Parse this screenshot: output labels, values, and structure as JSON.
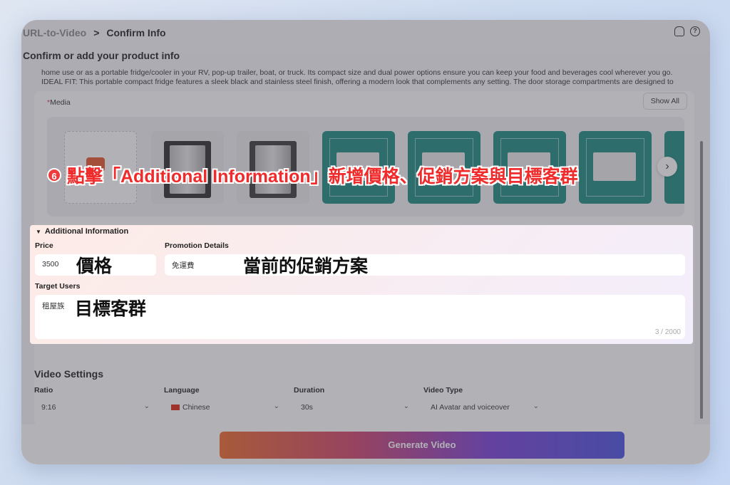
{
  "breadcrumb": {
    "parent": "URL-to-Video",
    "separator": ">",
    "current": "Confirm Info"
  },
  "page_title": "Confirm or add your product info",
  "description": {
    "line1": "home use or as a portable fridge/cooler in your RV, pop-up trailer, boat, or truck. Its compact size and dual power options ensure you can keep your food and beverages cool wherever you go.",
    "line2": "IDEAL FIT: This portable compact fridge features a sleek black and stainless steel finish, offering a modern look that complements any setting. The door storage compartments are designed to help"
  },
  "media": {
    "label": "Media",
    "required_mark": "*",
    "show_all": "Show All",
    "add_label": "Add",
    "thumbnails": [
      "add",
      "photo",
      "photo",
      "teal",
      "teal",
      "teal",
      "teal",
      "teal"
    ]
  },
  "additional_info": {
    "title": "Additional Information",
    "price_label": "Price",
    "price_value": "3500",
    "promotion_label": "Promotion Details",
    "promotion_value": "免運費",
    "target_label": "Target Users",
    "target_value": "租屋族",
    "counter": "3 / 2000"
  },
  "annotations": {
    "step_number": "6",
    "step_text": "點擊「Additional Information」新增價格、促銷方案與目標客群",
    "price_callout": "價格",
    "promotion_callout": "當前的促銷方案",
    "target_callout": "目標客群"
  },
  "video_settings": {
    "title": "Video Settings",
    "ratio_label": "Ratio",
    "ratio_value": "9:16",
    "language_label": "Language",
    "language_value": "Chinese",
    "duration_label": "Duration",
    "duration_value": "30s",
    "type_label": "Video Type",
    "type_value": "AI Avatar and voiceover"
  },
  "generate_button": "Generate Video",
  "colors": {
    "accent_red": "#ef2b2b",
    "teal": "#1d8c80"
  }
}
